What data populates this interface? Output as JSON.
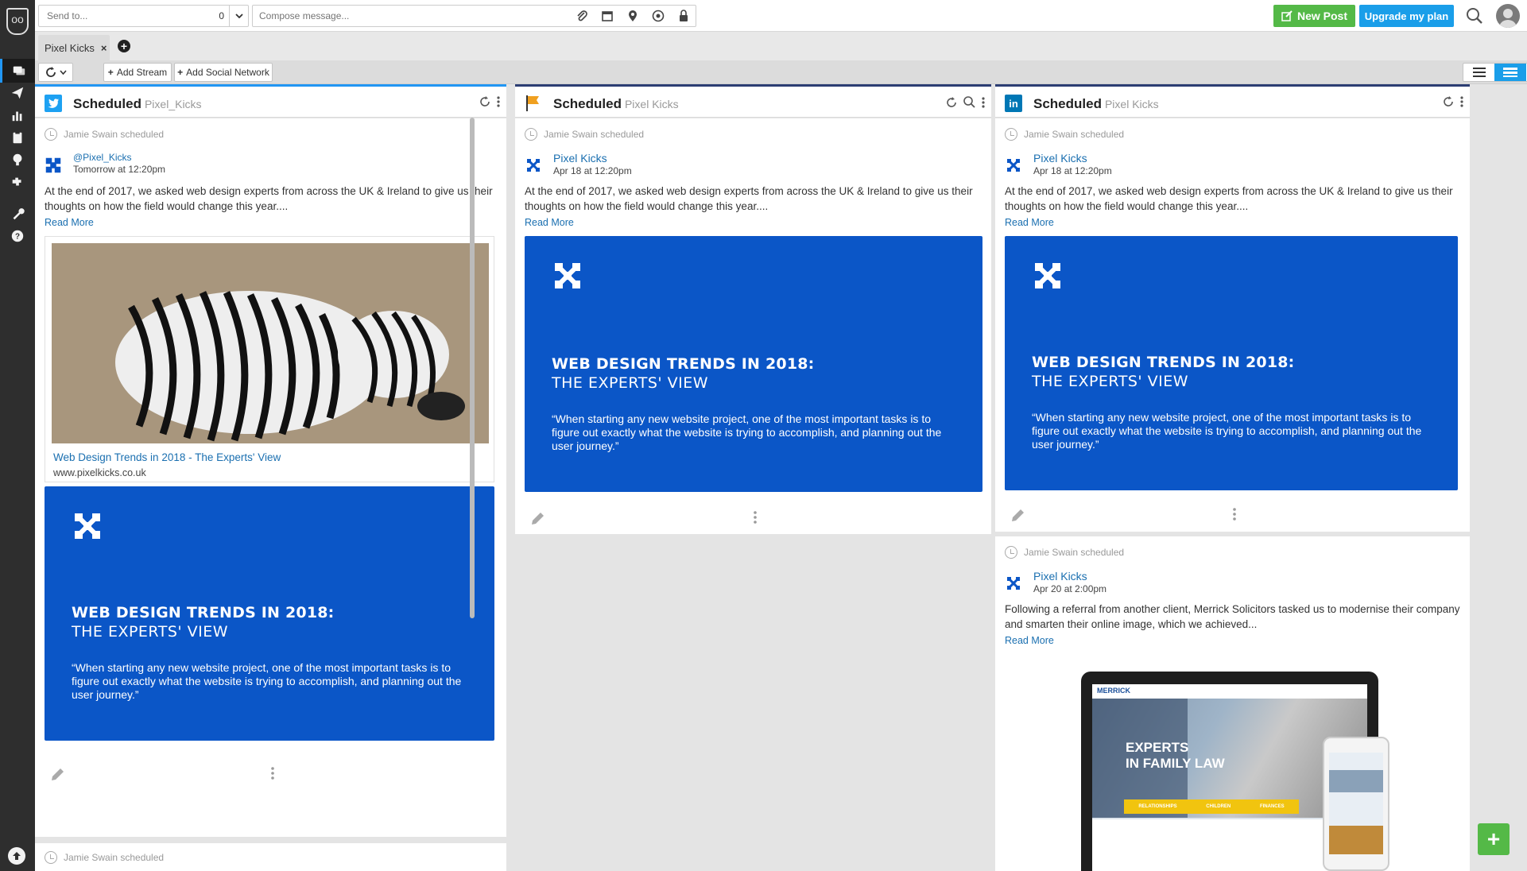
{
  "topbar": {
    "sendto_placeholder": "Send to...",
    "sendto_count": "0",
    "compose_placeholder": "Compose message...",
    "new_post_label": "New Post",
    "upgrade_label": "Upgrade my plan"
  },
  "tabs": [
    {
      "label": "Pixel Kicks"
    }
  ],
  "toolbar": {
    "add_stream_label": "Add Stream",
    "add_social_network_label": "Add Social Network"
  },
  "columns": [
    {
      "network": "twitter",
      "title": "Scheduled",
      "subtitle": "Pixel_Kicks",
      "posts": [
        {
          "scheduled_by": "Jamie Swain scheduled",
          "profile": "@Pixel_Kicks",
          "time": "Tomorrow at 12:20pm",
          "text": "At the end of 2017, we asked web design experts from across the UK & Ireland to give us their thoughts on how the field would change this year....",
          "read_more": "Read More",
          "link_title": "Web Design Trends in 2018 - The Experts' View",
          "link_url": "www.pixelkicks.co.uk",
          "image_heading": "WEB DESIGN TRENDS IN 2018:",
          "image_subheading": "THE EXPERTS' VIEW",
          "image_quote": "“When starting any new website project, one of the most important tasks is to figure out exactly what the website is trying to accomplish, and planning out the user journey.”"
        },
        {
          "scheduled_by": "Jamie Swain scheduled"
        }
      ]
    },
    {
      "network": "flag",
      "title": "Scheduled",
      "subtitle": "Pixel Kicks",
      "posts": [
        {
          "scheduled_by": "Jamie Swain scheduled",
          "profile": "Pixel Kicks",
          "time": "Apr 18 at 12:20pm",
          "text": "At the end of 2017, we asked web design experts from across the UK & Ireland to give us their thoughts on how the field would change this year....",
          "read_more": "Read More",
          "image_heading": "WEB DESIGN TRENDS IN 2018:",
          "image_subheading": "THE EXPERTS' VIEW",
          "image_quote": "“When starting any new website project, one of the most important tasks is to figure out exactly what the website is trying to accomplish, and planning out the user journey.”"
        }
      ]
    },
    {
      "network": "linkedin",
      "title": "Scheduled",
      "subtitle": "Pixel Kicks",
      "posts": [
        {
          "scheduled_by": "Jamie Swain scheduled",
          "profile": "Pixel Kicks",
          "time": "Apr 18 at 12:20pm",
          "text": "At the end of 2017, we asked web design experts from across the UK & Ireland to give us their thoughts on how the field would change this year....",
          "read_more": "Read More",
          "image_heading": "WEB DESIGN TRENDS IN 2018:",
          "image_subheading": "THE EXPERTS' VIEW",
          "image_quote": "“When starting any new website project, one of the most important tasks is to figure out exactly what the website is trying to accomplish, and planning out the user journey.”"
        },
        {
          "scheduled_by": "Jamie Swain scheduled",
          "profile": "Pixel Kicks",
          "time": "Apr 20 at 2:00pm",
          "text": "Following a referral from another client, Merrick Solicitors tasked us to modernise their company and smarten their online image, which we achieved...",
          "read_more": "Read More",
          "mockup_brand": "MERRICK",
          "mockup_headline_1": "EXPERTS",
          "mockup_headline_2": "IN FAMILY LAW",
          "mockup_nav_1": "RELATIONSHIPS",
          "mockup_nav_2": "CHILDREN",
          "mockup_nav_3": "FINANCES"
        }
      ]
    }
  ],
  "colors": {
    "accent": "#1a9ee9",
    "green": "#54b947",
    "brand_blue": "#0b56c7",
    "link": "#1a6fb0",
    "twitter": "#1da1f2",
    "linkedin": "#0077b5"
  }
}
